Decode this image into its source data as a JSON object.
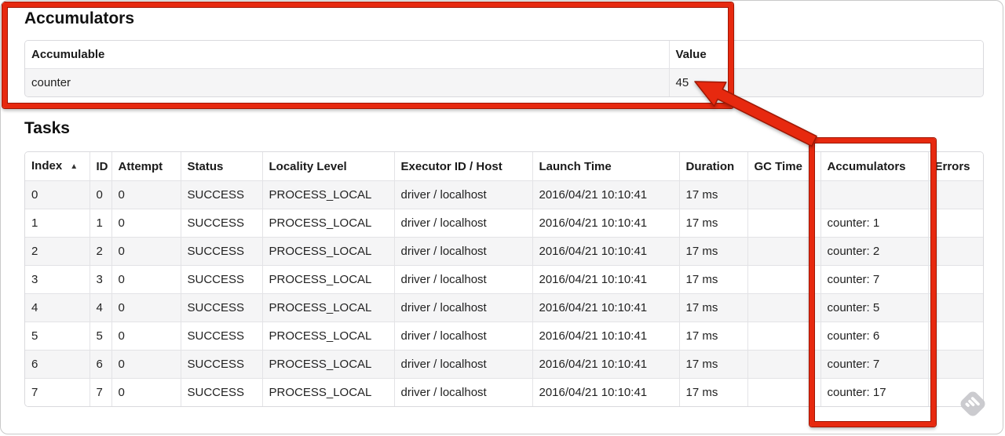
{
  "sections": {
    "accumulators": {
      "heading": "Accumulators",
      "table": {
        "columns": [
          "Accumulable",
          "Value"
        ],
        "rows": [
          [
            "counter",
            "45"
          ]
        ]
      }
    },
    "tasks": {
      "heading": "Tasks",
      "table": {
        "columns": [
          "Index",
          "ID",
          "Attempt",
          "Status",
          "Locality Level",
          "Executor ID / Host",
          "Launch Time",
          "Duration",
          "GC Time",
          "Accumulators",
          "Errors"
        ],
        "sort_column": "Index",
        "sort_icon": "▲",
        "rows": [
          [
            "0",
            "0",
            "0",
            "SUCCESS",
            "PROCESS_LOCAL",
            "driver / localhost",
            "2016/04/21 10:10:41",
            "17 ms",
            "",
            "",
            ""
          ],
          [
            "1",
            "1",
            "0",
            "SUCCESS",
            "PROCESS_LOCAL",
            "driver / localhost",
            "2016/04/21 10:10:41",
            "17 ms",
            "",
            "counter: 1",
            ""
          ],
          [
            "2",
            "2",
            "0",
            "SUCCESS",
            "PROCESS_LOCAL",
            "driver / localhost",
            "2016/04/21 10:10:41",
            "17 ms",
            "",
            "counter: 2",
            ""
          ],
          [
            "3",
            "3",
            "0",
            "SUCCESS",
            "PROCESS_LOCAL",
            "driver / localhost",
            "2016/04/21 10:10:41",
            "17 ms",
            "",
            "counter: 7",
            ""
          ],
          [
            "4",
            "4",
            "0",
            "SUCCESS",
            "PROCESS_LOCAL",
            "driver / localhost",
            "2016/04/21 10:10:41",
            "17 ms",
            "",
            "counter: 5",
            ""
          ],
          [
            "5",
            "5",
            "0",
            "SUCCESS",
            "PROCESS_LOCAL",
            "driver / localhost",
            "2016/04/21 10:10:41",
            "17 ms",
            "",
            "counter: 6",
            ""
          ],
          [
            "6",
            "6",
            "0",
            "SUCCESS",
            "PROCESS_LOCAL",
            "driver / localhost",
            "2016/04/21 10:10:41",
            "17 ms",
            "",
            "counter: 7",
            ""
          ],
          [
            "7",
            "7",
            "0",
            "SUCCESS",
            "PROCESS_LOCAL",
            "driver / localhost",
            "2016/04/21 10:10:41",
            "17 ms",
            "",
            "counter: 17",
            ""
          ]
        ]
      }
    }
  },
  "annotations": {
    "color": "#e7290f",
    "outline_color": "#9f1704",
    "arrow_points_to": "45"
  },
  "icons": {
    "sort_ascending": "▲",
    "watermark": "skitch-watermark"
  }
}
